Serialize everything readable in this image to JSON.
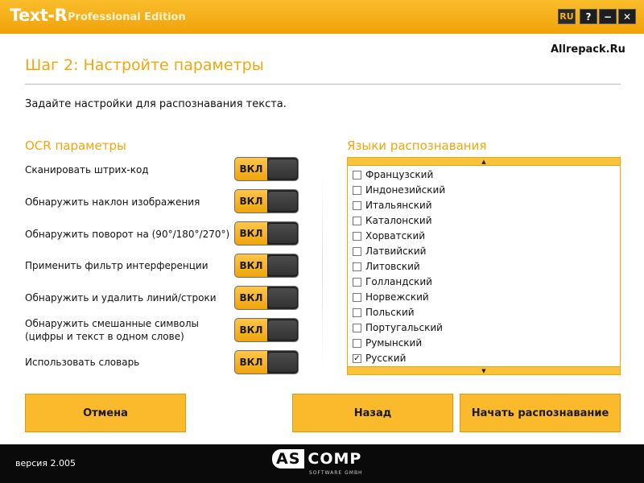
{
  "window": {
    "app_name": "Text-R",
    "edition": "Professional Edition",
    "lang_button": "RU",
    "help_button": "?",
    "minimize_button": "−",
    "close_button": "✕"
  },
  "watermark": "Allrepack.Ru",
  "step_title": "Шаг 2: Настройте параметры",
  "subtitle": "Задайте настройки для распознавания текста.",
  "ocr": {
    "title": "OCR параметры",
    "options": [
      {
        "label": "Сканировать штрих-код",
        "toggle": "ВКЛ"
      },
      {
        "label": "Обнаружить наклон изображения",
        "toggle": "ВКЛ"
      },
      {
        "label": "Обнаружить поворот на (90°/180°/270°)",
        "toggle": "ВКЛ"
      },
      {
        "label": "Применить фильтр интерференции",
        "toggle": "ВКЛ"
      },
      {
        "label": "Обнаружить и удалить линий/строки",
        "toggle": "ВКЛ"
      },
      {
        "label_line1": "Обнаружить смешанные символы",
        "label_line2": "(цифры и текст в одном слове)",
        "toggle": "ВКЛ"
      },
      {
        "label": "Использовать словарь",
        "toggle": "ВКЛ"
      }
    ]
  },
  "languages": {
    "title": "Языки распознавания",
    "scroll_up": "▲",
    "scroll_down": "▼",
    "check_mark": "✓",
    "items": [
      {
        "name": "Французский",
        "checked": false
      },
      {
        "name": "Индонезийский",
        "checked": false
      },
      {
        "name": "Итальянский",
        "checked": false
      },
      {
        "name": "Каталонский",
        "checked": false
      },
      {
        "name": "Хорватский",
        "checked": false
      },
      {
        "name": "Латвийский",
        "checked": false
      },
      {
        "name": "Литовский",
        "checked": false
      },
      {
        "name": "Голландский",
        "checked": false
      },
      {
        "name": "Норвежский",
        "checked": false
      },
      {
        "name": "Польский",
        "checked": false
      },
      {
        "name": "Португальский",
        "checked": false
      },
      {
        "name": "Румынский",
        "checked": false
      },
      {
        "name": "Русский",
        "checked": true
      }
    ]
  },
  "buttons": {
    "cancel": "Отмена",
    "back": "Назад",
    "start": "Начать распознавание"
  },
  "footer": {
    "version": "версия 2.005",
    "logo_left": "AS",
    "logo_right": "COMP",
    "logo_sub": "SOFTWARE GMBH"
  },
  "colors": {
    "accent": "#f5b21c",
    "footer": "#0a0a0a"
  }
}
